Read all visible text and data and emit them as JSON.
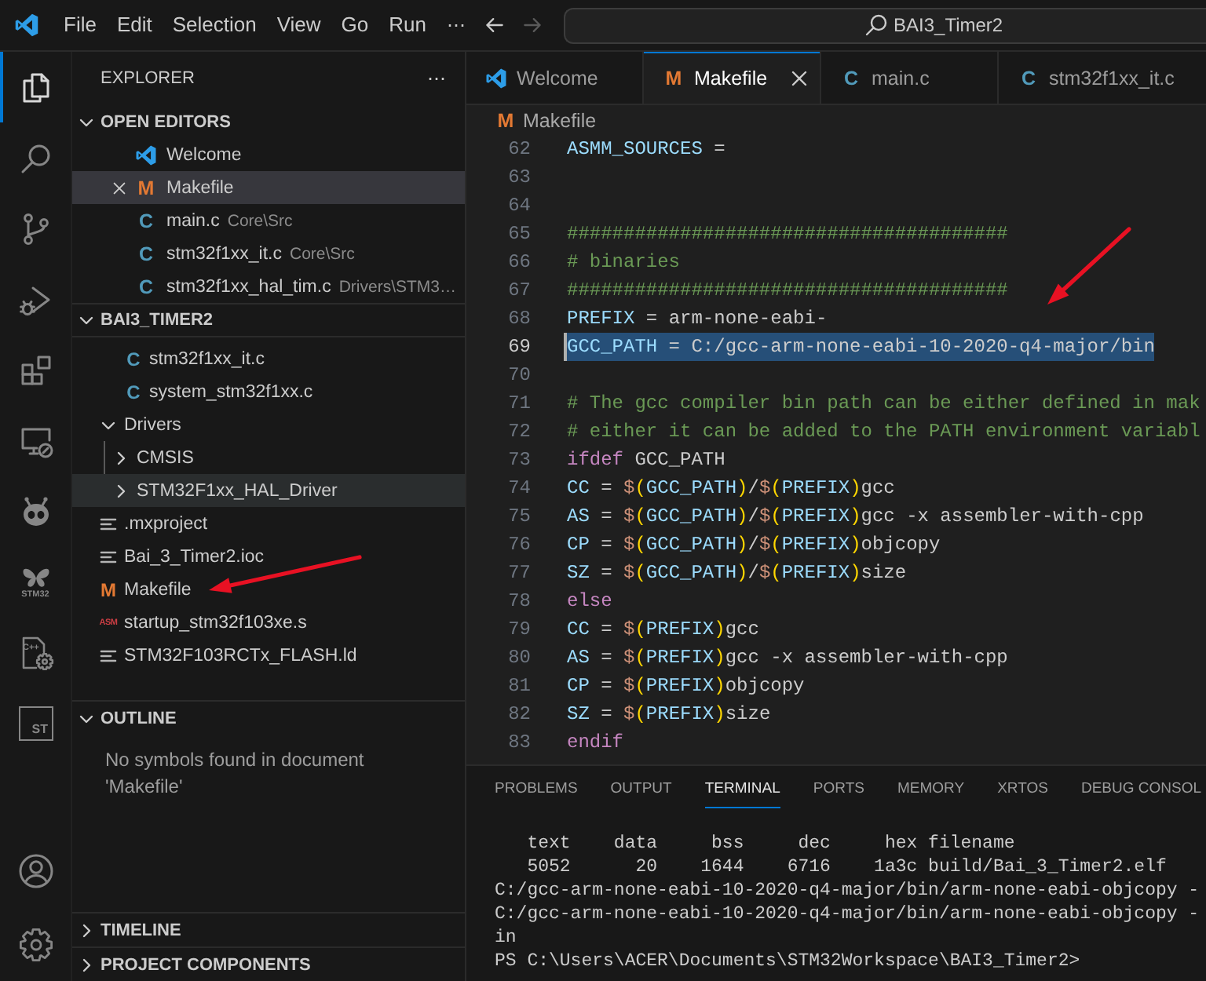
{
  "title_bar": {
    "menu": [
      "File",
      "Edit",
      "Selection",
      "View",
      "Go",
      "Run"
    ],
    "more": "⋯",
    "back": {
      "disabled": false
    },
    "forward": {
      "disabled": true
    },
    "search": {
      "value": "BAI3_Timer2"
    }
  },
  "activity_bar": {
    "items": [
      {
        "kind": "explorer",
        "selected": true
      },
      {
        "kind": "search",
        "selected": false
      },
      {
        "kind": "source-control",
        "selected": false
      },
      {
        "kind": "run-debug",
        "selected": false
      },
      {
        "kind": "extensions",
        "selected": false
      },
      {
        "kind": "remote",
        "selected": false
      },
      {
        "kind": "alien",
        "selected": false
      },
      {
        "kind": "butterfly",
        "label": "STM32",
        "selected": false
      },
      {
        "kind": "cpp-config",
        "label": "C++",
        "selected": false
      },
      {
        "kind": "st-box",
        "label": "ST",
        "selected": false
      }
    ],
    "bottom_items": [
      {
        "kind": "account"
      },
      {
        "kind": "settings"
      }
    ]
  },
  "sidebar": {
    "title": "EXPLORER",
    "more": "⋯",
    "sections": [
      {
        "kind": "open-editors",
        "title": "OPEN EDITORS",
        "expanded": true,
        "items": [
          {
            "label": "Welcome",
            "icon": {
              "kind": "vscode"
            },
            "selected": false
          },
          {
            "label": "Makefile",
            "icon": {
              "kind": "makefile",
              "glyph": "M"
            },
            "selected": true
          },
          {
            "label": "main.c",
            "icon": {
              "kind": "c",
              "glyph": "C"
            },
            "detail": "Core\\Src",
            "selected": false
          },
          {
            "label": "stm32f1xx_it.c",
            "icon": {
              "kind": "c",
              "glyph": "C"
            },
            "detail": "Core\\Src",
            "selected": false
          },
          {
            "label": "stm32f1xx_hal_tim.c",
            "icon": {
              "kind": "c",
              "glyph": "C"
            },
            "detail": "Drivers\\STM3…",
            "selected": false
          }
        ]
      },
      {
        "kind": "tree",
        "title": "BAI3_TIMER2",
        "expanded": true,
        "items": [
          {
            "children": [
              {
                "children": [
                  {
                    "label": "stm32f1xx_it.c",
                    "icon": {
                      "kind": "c",
                      "glyph": "C"
                    },
                    "hovered": false
                  },
                  {
                    "label": "system_stm32f1xx.c",
                    "icon": {
                      "kind": "c",
                      "glyph": "C"
                    },
                    "hovered": false
                  }
                ]
              }
            ]
          },
          {
            "label": "Drivers",
            "kind": "folder",
            "expanded": true,
            "hovered": false,
            "children": [
              {
                "label": "CMSIS",
                "kind": "folder",
                "expanded": false,
                "hovered": false
              },
              {
                "label": "STM32F1xx_HAL_Driver",
                "kind": "folder",
                "expanded": false,
                "hovered": true
              }
            ]
          },
          {
            "label": ".mxproject",
            "icon": {
              "kind": "lines"
            },
            "hovered": false
          },
          {
            "label": "Bai_3_Timer2.ioc",
            "icon": {
              "kind": "lines"
            },
            "hovered": false
          },
          {
            "label": "Makefile",
            "icon": {
              "kind": "makefile",
              "glyph": "M"
            },
            "hovered": false
          },
          {
            "label": "startup_stm32f103xe.s",
            "icon": {
              "kind": "asm",
              "glyph": "ASM"
            },
            "hovered": false
          },
          {
            "label": "STM32F103RCTx_FLASH.ld",
            "icon": {
              "kind": "lines"
            },
            "hovered": false
          }
        ]
      },
      {
        "kind": "message",
        "title": "OUTLINE",
        "expanded": true,
        "message": "No symbols found in document 'Makefile'"
      },
      {
        "kind": "collapsed",
        "title": "TIMELINE",
        "expanded": false
      },
      {
        "kind": "collapsed",
        "title": "PROJECT COMPONENTS",
        "expanded": false
      }
    ]
  },
  "editor": {
    "tabs": [
      {
        "label": "Welcome",
        "icon": {
          "kind": "vscode"
        },
        "selected": false
      },
      {
        "label": "Makefile",
        "icon": {
          "kind": "makefile",
          "glyph": "M"
        },
        "selected": true
      },
      {
        "label": "main.c",
        "icon": {
          "kind": "c",
          "glyph": "C"
        },
        "selected": false
      },
      {
        "label": "stm32f1xx_it.c",
        "icon": {
          "kind": "c",
          "glyph": "C"
        },
        "selected": false
      }
    ],
    "breadcrumb": {
      "label": "Makefile",
      "icon": {
        "kind": "makefile",
        "glyph": "M"
      }
    },
    "lines": [
      {
        "number": "62",
        "selected": false,
        "tokens": [
          {
            "kind": "var",
            "text": "ASMM_SOURCES"
          },
          {
            "kind": "plain",
            "text": " ="
          }
        ]
      },
      {
        "number": "63",
        "selected": false
      },
      {
        "number": "64",
        "selected": false
      },
      {
        "number": "65",
        "selected": false,
        "tokens": [
          {
            "kind": "comment",
            "text": "#######################################"
          }
        ]
      },
      {
        "number": "66",
        "selected": false,
        "tokens": [
          {
            "kind": "comment",
            "text": "# binaries"
          }
        ]
      },
      {
        "number": "67",
        "selected": false,
        "tokens": [
          {
            "kind": "comment",
            "text": "#######################################"
          }
        ]
      },
      {
        "number": "68",
        "selected": false,
        "tokens": [
          {
            "kind": "var",
            "text": "PREFIX"
          },
          {
            "kind": "plain",
            "text": " = arm-none-eabi-"
          }
        ]
      },
      {
        "number": "69",
        "selected": true,
        "tokens": [
          {
            "kind": "var",
            "text": "GCC_PATH"
          },
          {
            "kind": "plain",
            "text": " = C:/gcc-arm-none-eabi-10-2020-q4-major/bin"
          }
        ]
      },
      {
        "number": "70",
        "selected": false
      },
      {
        "number": "71",
        "selected": false,
        "tokens": [
          {
            "kind": "comment",
            "text": "# The gcc compiler bin path can be either defined in mak"
          }
        ]
      },
      {
        "number": "72",
        "selected": false,
        "tokens": [
          {
            "kind": "comment",
            "text": "# either it can be added to the PATH environment variabl"
          }
        ]
      },
      {
        "number": "73",
        "selected": false,
        "tokens": [
          {
            "kind": "keyword",
            "text": "ifdef"
          },
          {
            "kind": "plain",
            "text": " GCC_PATH"
          }
        ]
      },
      {
        "number": "74",
        "selected": false,
        "tokens": [
          {
            "kind": "var",
            "text": "CC"
          },
          {
            "kind": "plain",
            "text": " = "
          },
          {
            "kind": "dollar",
            "text": "$"
          },
          {
            "kind": "paren",
            "text": "("
          },
          {
            "kind": "var",
            "text": "GCC_PATH"
          },
          {
            "kind": "paren",
            "text": ")"
          },
          {
            "kind": "plain",
            "text": "/"
          },
          {
            "kind": "dollar",
            "text": "$"
          },
          {
            "kind": "paren",
            "text": "("
          },
          {
            "kind": "var",
            "text": "PREFIX"
          },
          {
            "kind": "paren",
            "text": ")"
          },
          {
            "kind": "plain",
            "text": "gcc"
          }
        ]
      },
      {
        "number": "75",
        "selected": false,
        "tokens": [
          {
            "kind": "var",
            "text": "AS"
          },
          {
            "kind": "plain",
            "text": " = "
          },
          {
            "kind": "dollar",
            "text": "$"
          },
          {
            "kind": "paren",
            "text": "("
          },
          {
            "kind": "var",
            "text": "GCC_PATH"
          },
          {
            "kind": "paren",
            "text": ")"
          },
          {
            "kind": "plain",
            "text": "/"
          },
          {
            "kind": "dollar",
            "text": "$"
          },
          {
            "kind": "paren",
            "text": "("
          },
          {
            "kind": "var",
            "text": "PREFIX"
          },
          {
            "kind": "paren",
            "text": ")"
          },
          {
            "kind": "plain",
            "text": "gcc -x assembler-with-cpp"
          }
        ]
      },
      {
        "number": "76",
        "selected": false,
        "tokens": [
          {
            "kind": "var",
            "text": "CP"
          },
          {
            "kind": "plain",
            "text": " = "
          },
          {
            "kind": "dollar",
            "text": "$"
          },
          {
            "kind": "paren",
            "text": "("
          },
          {
            "kind": "var",
            "text": "GCC_PATH"
          },
          {
            "kind": "paren",
            "text": ")"
          },
          {
            "kind": "plain",
            "text": "/"
          },
          {
            "kind": "dollar",
            "text": "$"
          },
          {
            "kind": "paren",
            "text": "("
          },
          {
            "kind": "var",
            "text": "PREFIX"
          },
          {
            "kind": "paren",
            "text": ")"
          },
          {
            "kind": "plain",
            "text": "objcopy"
          }
        ]
      },
      {
        "number": "77",
        "selected": false,
        "tokens": [
          {
            "kind": "var",
            "text": "SZ"
          },
          {
            "kind": "plain",
            "text": " = "
          },
          {
            "kind": "dollar",
            "text": "$"
          },
          {
            "kind": "paren",
            "text": "("
          },
          {
            "kind": "var",
            "text": "GCC_PATH"
          },
          {
            "kind": "paren",
            "text": ")"
          },
          {
            "kind": "plain",
            "text": "/"
          },
          {
            "kind": "dollar",
            "text": "$"
          },
          {
            "kind": "paren",
            "text": "("
          },
          {
            "kind": "var",
            "text": "PREFIX"
          },
          {
            "kind": "paren",
            "text": ")"
          },
          {
            "kind": "plain",
            "text": "size"
          }
        ]
      },
      {
        "number": "78",
        "selected": false,
        "tokens": [
          {
            "kind": "keyword",
            "text": "else"
          }
        ]
      },
      {
        "number": "79",
        "selected": false,
        "tokens": [
          {
            "kind": "var",
            "text": "CC"
          },
          {
            "kind": "plain",
            "text": " = "
          },
          {
            "kind": "dollar",
            "text": "$"
          },
          {
            "kind": "paren",
            "text": "("
          },
          {
            "kind": "var",
            "text": "PREFIX"
          },
          {
            "kind": "paren",
            "text": ")"
          },
          {
            "kind": "plain",
            "text": "gcc"
          }
        ]
      },
      {
        "number": "80",
        "selected": false,
        "tokens": [
          {
            "kind": "var",
            "text": "AS"
          },
          {
            "kind": "plain",
            "text": " = "
          },
          {
            "kind": "dollar",
            "text": "$"
          },
          {
            "kind": "paren",
            "text": "("
          },
          {
            "kind": "var",
            "text": "PREFIX"
          },
          {
            "kind": "paren",
            "text": ")"
          },
          {
            "kind": "plain",
            "text": "gcc -x assembler-with-cpp"
          }
        ]
      },
      {
        "number": "81",
        "selected": false,
        "tokens": [
          {
            "kind": "var",
            "text": "CP"
          },
          {
            "kind": "plain",
            "text": " = "
          },
          {
            "kind": "dollar",
            "text": "$"
          },
          {
            "kind": "paren",
            "text": "("
          },
          {
            "kind": "var",
            "text": "PREFIX"
          },
          {
            "kind": "paren",
            "text": ")"
          },
          {
            "kind": "plain",
            "text": "objcopy"
          }
        ]
      },
      {
        "number": "82",
        "selected": false,
        "tokens": [
          {
            "kind": "var",
            "text": "SZ"
          },
          {
            "kind": "plain",
            "text": " = "
          },
          {
            "kind": "dollar",
            "text": "$"
          },
          {
            "kind": "paren",
            "text": "("
          },
          {
            "kind": "var",
            "text": "PREFIX"
          },
          {
            "kind": "paren",
            "text": ")"
          },
          {
            "kind": "plain",
            "text": "size"
          }
        ]
      },
      {
        "number": "83",
        "selected": false,
        "tokens": [
          {
            "kind": "keyword",
            "text": "endif"
          }
        ]
      }
    ]
  },
  "panel": {
    "tabs": [
      {
        "label": "PROBLEMS",
        "selected": false
      },
      {
        "label": "OUTPUT",
        "selected": false
      },
      {
        "label": "TERMINAL",
        "selected": true
      },
      {
        "label": "PORTS",
        "selected": false
      },
      {
        "label": "MEMORY",
        "selected": false
      },
      {
        "label": "XRTOS",
        "selected": false
      },
      {
        "label": "DEBUG CONSOL",
        "selected": false
      }
    ],
    "terminal": {
      "lines": [
        "   text    data     bss     dec     hex filename",
        "   5052      20    1644    6716    1a3c build/Bai_3_Timer2.elf",
        "C:/gcc-arm-none-eabi-10-2020-q4-major/bin/arm-none-eabi-objcopy -",
        "C:/gcc-arm-none-eabi-10-2020-q4-major/bin/arm-none-eabi-objcopy -",
        "in",
        "PS C:\\Users\\ACER\\Documents\\STM32Workspace\\BAI3_Timer2>"
      ]
    }
  },
  "annotations": [
    {
      "kind": "arrow"
    },
    {
      "kind": "arrow"
    }
  ]
}
